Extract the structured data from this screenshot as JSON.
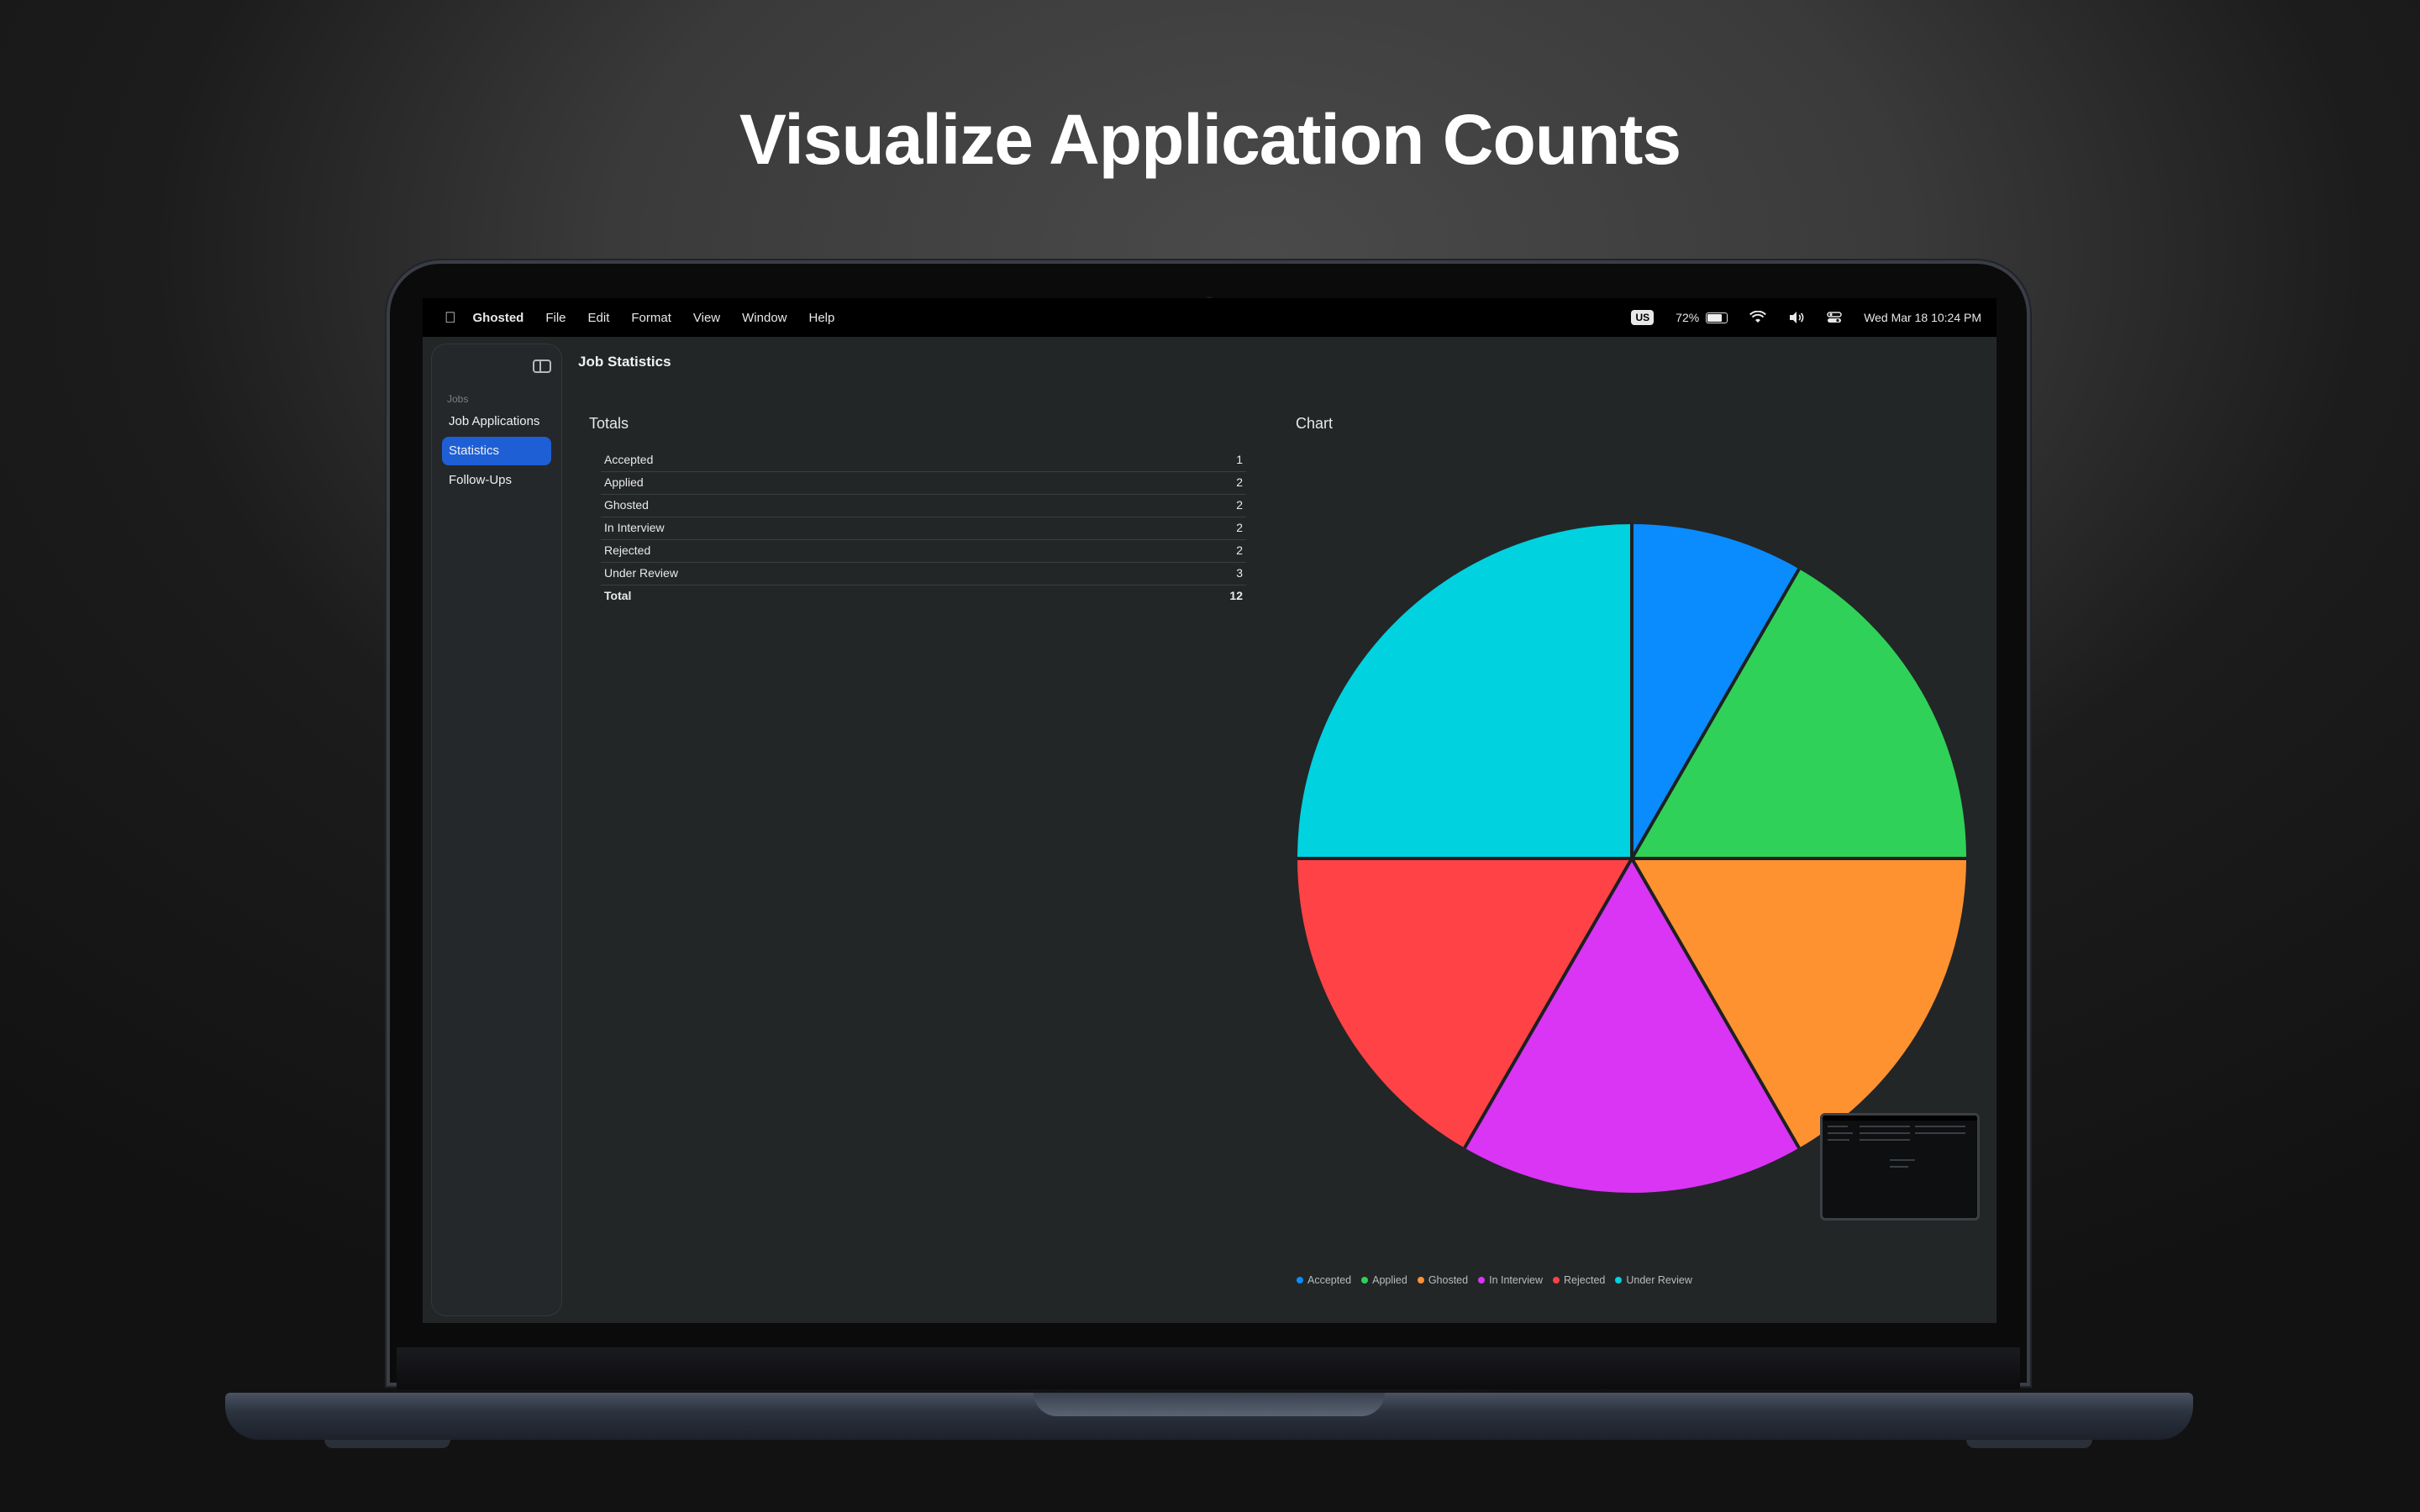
{
  "headline": "Visualize Application Counts",
  "menubar": {
    "app_name": "Ghosted",
    "menus": [
      "File",
      "Edit",
      "Format",
      "View",
      "Window",
      "Help"
    ],
    "input_source": "US",
    "battery_percent": "72%",
    "battery_level": 0.72,
    "datetime": "Wed Mar 18  10:24 PM"
  },
  "window": {
    "title": "Job Statistics"
  },
  "sidebar": {
    "section_label": "Jobs",
    "items": [
      {
        "label": "Job Applications",
        "active": false
      },
      {
        "label": "Statistics",
        "active": true
      },
      {
        "label": "Follow-Ups",
        "active": false
      }
    ]
  },
  "totals": {
    "heading": "Totals",
    "rows": [
      {
        "label": "Accepted",
        "value": "1"
      },
      {
        "label": "Applied",
        "value": "2"
      },
      {
        "label": "Ghosted",
        "value": "2"
      },
      {
        "label": "In Interview",
        "value": "2"
      },
      {
        "label": "Rejected",
        "value": "2"
      },
      {
        "label": "Under Review",
        "value": "3"
      }
    ],
    "total_label": "Total",
    "total_value": "12"
  },
  "chart_heading": "Chart",
  "chart_data": {
    "type": "pie",
    "categories": [
      "Accepted",
      "Applied",
      "Ghosted",
      "In Interview",
      "Rejected",
      "Under Review"
    ],
    "values": [
      1,
      2,
      2,
      2,
      2,
      3
    ],
    "colors": [
      "#0a8cff",
      "#30d158",
      "#ff9230",
      "#da34f5",
      "#ff4245",
      "#00d2e0"
    ],
    "legend_position": "bottom-left"
  },
  "icons": {
    "apple": "apple-logo-icon",
    "sidebar_toggle": "sidebar-toggle-icon",
    "wifi": "wifi-icon",
    "volume": "speaker-icon",
    "control_center": "control-center-icon"
  }
}
